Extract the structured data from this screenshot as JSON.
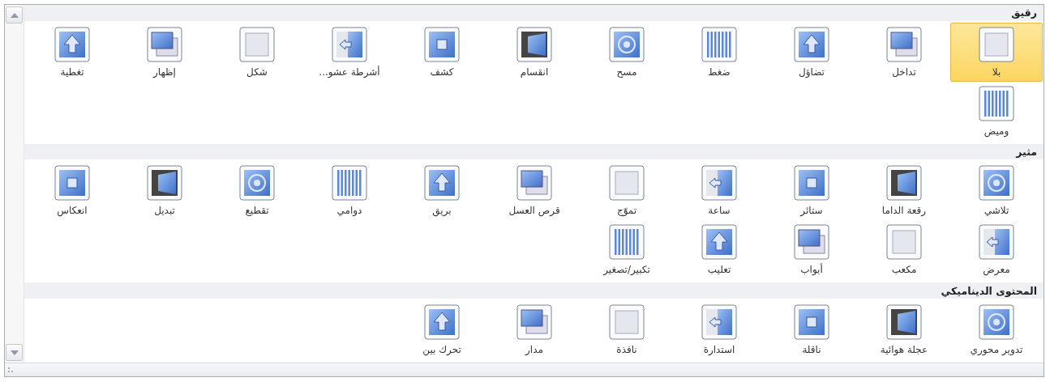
{
  "sections": [
    {
      "title": "رقيق",
      "items": [
        {
          "label": "بلا",
          "selected": true
        },
        {
          "label": "تداخل",
          "selected": false
        },
        {
          "label": "تضاؤل",
          "selected": false
        },
        {
          "label": "ضغط",
          "selected": false
        },
        {
          "label": "مسح",
          "selected": false
        },
        {
          "label": "انقسام",
          "selected": false
        },
        {
          "label": "كشف",
          "selected": false
        },
        {
          "label": "أشرطة عشو...",
          "selected": false
        },
        {
          "label": "شكل",
          "selected": false
        },
        {
          "label": "إظهار",
          "selected": false
        },
        {
          "label": "تغطية",
          "selected": false
        },
        {
          "label": "وميض",
          "selected": false
        }
      ]
    },
    {
      "title": "مثير",
      "items": [
        {
          "label": "تلاشي",
          "selected": false
        },
        {
          "label": "رقعة الداما",
          "selected": false
        },
        {
          "label": "ستائر",
          "selected": false
        },
        {
          "label": "ساعة",
          "selected": false
        },
        {
          "label": "تموّج",
          "selected": false
        },
        {
          "label": "قرص العسل",
          "selected": false
        },
        {
          "label": "بريق",
          "selected": false
        },
        {
          "label": "دوامي",
          "selected": false
        },
        {
          "label": "تقطيع",
          "selected": false
        },
        {
          "label": "تبديل",
          "selected": false
        },
        {
          "label": "انعكاس",
          "selected": false
        },
        {
          "label": "معرض",
          "selected": false
        },
        {
          "label": "مكعب",
          "selected": false
        },
        {
          "label": "أبواب",
          "selected": false
        },
        {
          "label": "تعليب",
          "selected": false
        },
        {
          "label": "تكبير/تصغير",
          "selected": false
        }
      ]
    },
    {
      "title": "المحتوى الديناميكي",
      "items": [
        {
          "label": "تدوير محوري",
          "selected": false
        },
        {
          "label": "عجلة هوائية",
          "selected": false
        },
        {
          "label": "ناقلة",
          "selected": false
        },
        {
          "label": "استدارة",
          "selected": false
        },
        {
          "label": "نافذة",
          "selected": false
        },
        {
          "label": "مدار",
          "selected": false
        },
        {
          "label": "تحرك بين",
          "selected": false
        }
      ]
    }
  ]
}
